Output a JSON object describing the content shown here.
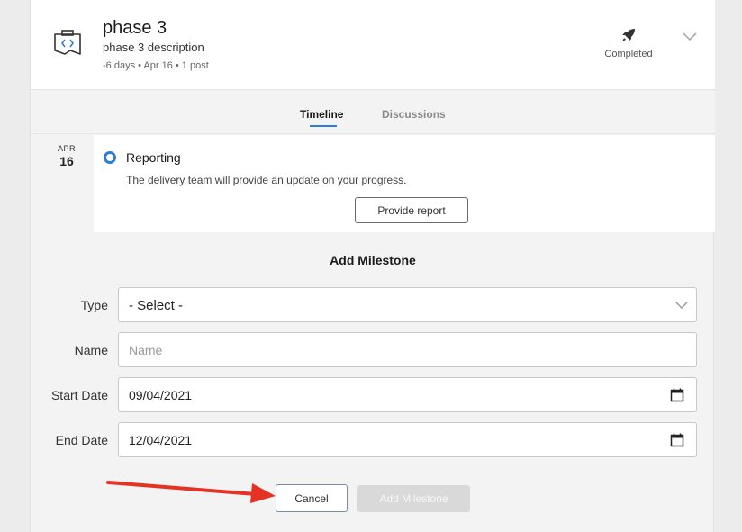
{
  "phase": {
    "title": "phase 3",
    "description": "phase 3 description",
    "meta": "-6 days • Apr 16 • 1 post",
    "status": "Completed",
    "icon": "code-window-icon",
    "status_icon": "rocket-icon"
  },
  "tabs": {
    "timeline": "Timeline",
    "discussions": "Discussions",
    "active": "timeline"
  },
  "event": {
    "month": "APR",
    "day": "16",
    "title": "Reporting",
    "description": "The delivery team will provide an update on your progress.",
    "button": "Provide report"
  },
  "form": {
    "title": "Add Milestone",
    "type_label": "Type",
    "type_value": "- Select -",
    "name_label": "Name",
    "name_placeholder": "Name",
    "start_label": "Start Date",
    "start_value": "09/04/2021",
    "end_label": "End Date",
    "end_value": "12/04/2021",
    "cancel_button": "Cancel",
    "add_button": "Add Milestone"
  },
  "colors": {
    "accent": "#2d7be0",
    "annotation_arrow": "#e53222",
    "disabled_button": "#d9d9d9"
  }
}
